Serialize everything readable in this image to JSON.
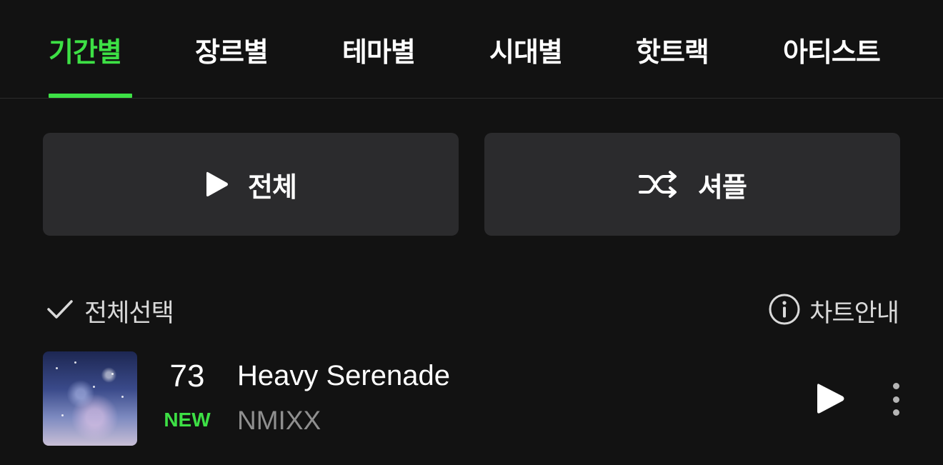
{
  "tabs": [
    {
      "label": "기간별",
      "active": true
    },
    {
      "label": "장르별",
      "active": false
    },
    {
      "label": "테마별",
      "active": false
    },
    {
      "label": "시대별",
      "active": false
    },
    {
      "label": "핫트랙",
      "active": false
    },
    {
      "label": "아티스트",
      "active": false
    }
  ],
  "actions": {
    "play_all_label": "전체",
    "shuffle_label": "셔플"
  },
  "list_controls": {
    "select_all_label": "전체선택",
    "chart_info_label": "차트안내"
  },
  "track": {
    "rank": "73",
    "badge": "NEW",
    "title": "Heavy Serenade",
    "artist": "NMIXX",
    "album_art_icon": "album-cover"
  },
  "colors": {
    "accent": "#3de045",
    "background": "#121212",
    "button_bg": "#2b2b2d",
    "secondary_text": "#8f8f8f"
  }
}
